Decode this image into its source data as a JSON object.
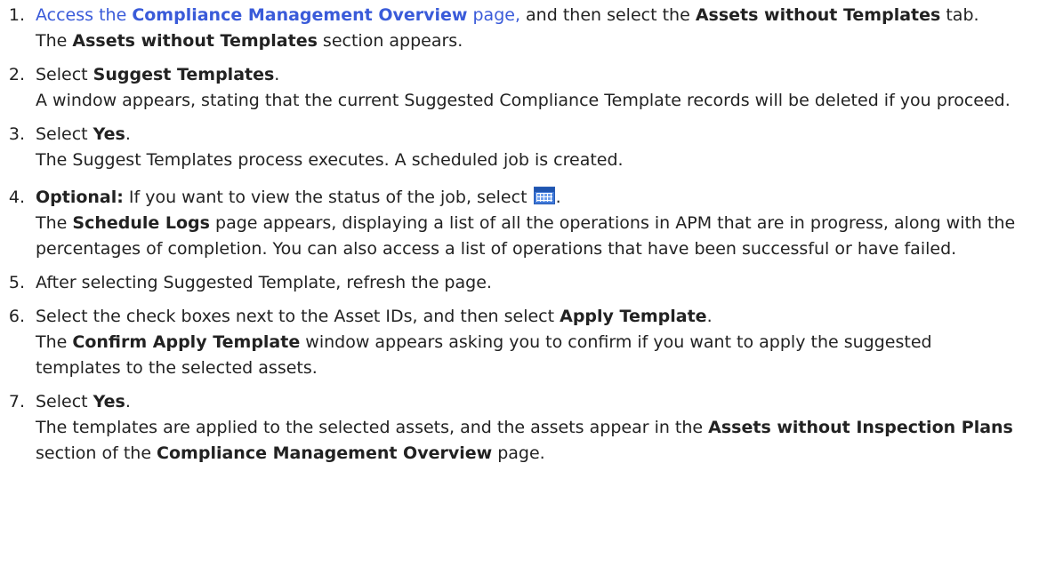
{
  "steps": [
    {
      "num": "1.",
      "link_prefix": "Access the ",
      "link_bold": "Compliance Management Overview",
      "link_suffix": " page,",
      "text1": " and then select the ",
      "bold1": "Assets without Templates",
      "text2": " tab.",
      "result_bold": "Assets without Templates",
      "result_text": " section appears."
    },
    {
      "num": "2.",
      "text1": "Select ",
      "bold1": "Suggest Templates",
      "text2": ".",
      "result_text": "A window appears, stating that the current Suggested Compliance Template records will be deleted if you proceed."
    },
    {
      "num": "3.",
      "text1": "Select ",
      "bold1": "Yes",
      "text2": ".",
      "result_text": "The Suggest Templates process executes. A scheduled job is created."
    },
    {
      "num": "4.",
      "bold1": "Optional:",
      "text1": " If you want to view the status of the job, select ",
      "text2": ".",
      "icon": "calendar-icon",
      "result_prefix": "The ",
      "result_bold": "Schedule Logs",
      "result_text": " page appears, displaying a list of all the operations in APM that are in progress, along with the percentages of completion. You can also access a list of operations that have been successful or have failed."
    },
    {
      "num": "5.",
      "text1": "After selecting Suggested Template, refresh the page."
    },
    {
      "num": "6.",
      "text1": "Select the check boxes next to the Asset IDs, and then select ",
      "bold1": "Apply Template",
      "text2": ".",
      "result_prefix": "The ",
      "result_bold": "Confirm Apply Template",
      "result_text": " window appears asking you to confirm if you want to apply the suggested templates to the selected assets."
    },
    {
      "num": "7.",
      "text1": "Select ",
      "bold1": "Yes",
      "text2": ".",
      "result_text": "The templates are applied to the selected assets, and the assets appear in the ",
      "result_bold": "Assets without Inspection Plans",
      "result_text2": " section of the ",
      "result_bold2": "Compliance Management Overview",
      "result_text3": " page."
    }
  ],
  "colors": {
    "link": "#3a5bd9",
    "text": "#222222"
  }
}
